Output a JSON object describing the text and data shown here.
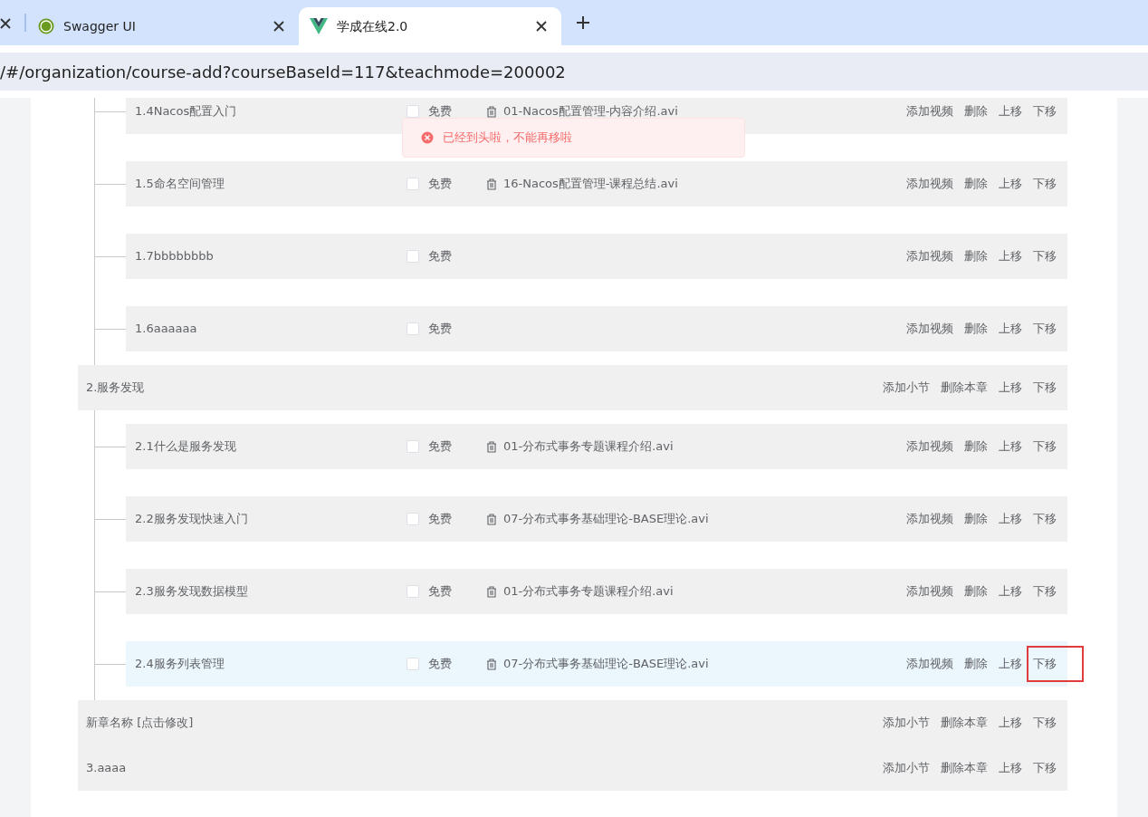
{
  "browser": {
    "tabs": [
      {
        "title": "Swagger UI",
        "selected": false
      },
      {
        "title": "学成在线2.0",
        "selected": true
      }
    ],
    "address": "/#/organization/course-add?courseBaseId=117&teachmode=200002"
  },
  "message": {
    "text": "已经到头啦，不能再移啦"
  },
  "chapters": [
    {
      "children": [
        {
          "title": "1.4Nacos配置入门",
          "free_label": "免费",
          "free": false,
          "video": "01-Nacos配置管理-内容介绍.avi",
          "hovered": false,
          "actions": [
            {
              "label": "添加视频"
            },
            {
              "label": "删除"
            },
            {
              "label": "上移"
            },
            {
              "label": "下移"
            }
          ]
        },
        {
          "title": "1.5命名空间管理",
          "free_label": "免费",
          "free": false,
          "video": "16-Nacos配置管理-课程总结.avi",
          "hovered": false,
          "actions": [
            {
              "label": "添加视频"
            },
            {
              "label": "删除"
            },
            {
              "label": "上移"
            },
            {
              "label": "下移"
            }
          ]
        },
        {
          "title": "1.7bbbbbbbb",
          "free_label": "免费",
          "free": false,
          "hovered": false,
          "actions": [
            {
              "label": "添加视频"
            },
            {
              "label": "删除"
            },
            {
              "label": "上移"
            },
            {
              "label": "下移"
            }
          ]
        },
        {
          "title": "1.6aaaaaa",
          "free_label": "免费",
          "free": false,
          "hovered": false,
          "actions": [
            {
              "label": "添加视频"
            },
            {
              "label": "删除"
            },
            {
              "label": "上移"
            },
            {
              "label": "下移"
            }
          ]
        }
      ]
    },
    {
      "title": "2.服务发现",
      "actions": [
        {
          "label": "添加小节"
        },
        {
          "label": "删除本章"
        },
        {
          "label": "上移"
        },
        {
          "label": "下移"
        }
      ],
      "children": [
        {
          "title": "2.1什么是服务发现",
          "free_label": "免费",
          "free": false,
          "video": "01-分布式事务专题课程介绍.avi",
          "hovered": false,
          "actions": [
            {
              "label": "添加视频"
            },
            {
              "label": "删除"
            },
            {
              "label": "上移"
            },
            {
              "label": "下移"
            }
          ]
        },
        {
          "title": "2.2服务发现快速入门",
          "free_label": "免费",
          "free": false,
          "video": "07-分布式事务基础理论-BASE理论.avi",
          "hovered": false,
          "actions": [
            {
              "label": "添加视频"
            },
            {
              "label": "删除"
            },
            {
              "label": "上移"
            },
            {
              "label": "下移"
            }
          ]
        },
        {
          "title": "2.3服务发现数据模型",
          "free_label": "免费",
          "free": false,
          "video": "01-分布式事务专题课程介绍.avi",
          "hovered": false,
          "actions": [
            {
              "label": "添加视频"
            },
            {
              "label": "删除"
            },
            {
              "label": "上移"
            },
            {
              "label": "下移"
            }
          ]
        },
        {
          "title": "2.4服务列表管理",
          "free_label": "免费",
          "free": false,
          "video": "07-分布式事务基础理论-BASE理论.avi",
          "hovered": true,
          "actions": [
            {
              "label": "添加视频"
            },
            {
              "label": "删除"
            },
            {
              "label": "上移"
            },
            {
              "label": "下移",
              "boxed": true
            }
          ]
        }
      ]
    },
    {
      "title": "新章名称 [点击修改]",
      "actions": [
        {
          "label": "添加小节"
        },
        {
          "label": "删除本章"
        },
        {
          "label": "上移"
        },
        {
          "label": "下移"
        }
      ]
    },
    {
      "title": "3.aaaa",
      "actions": [
        {
          "label": "添加小节"
        },
        {
          "label": "删除本章"
        },
        {
          "label": "上移"
        },
        {
          "label": "下移"
        }
      ]
    }
  ]
}
